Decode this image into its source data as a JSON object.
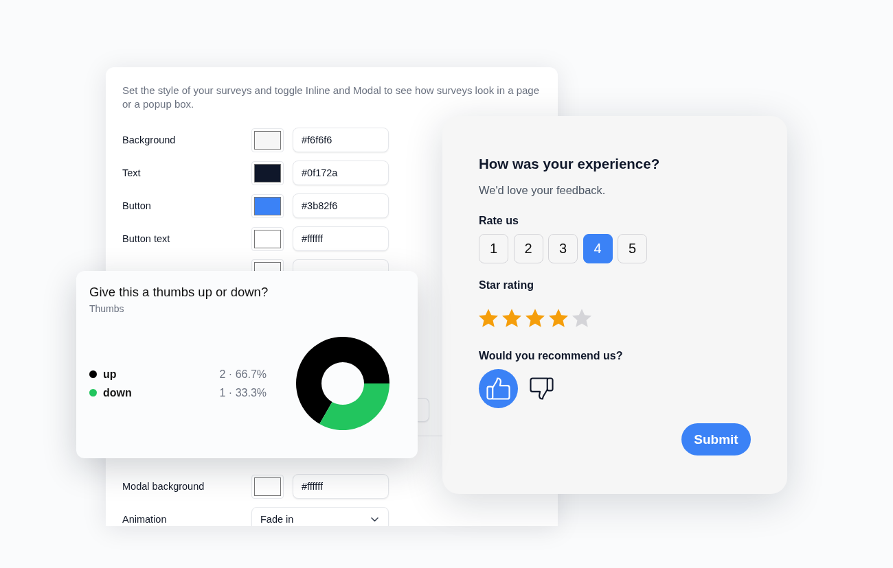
{
  "settings_panel": {
    "description": "Set the style of your surveys and toggle Inline and Modal to see how surveys look in a page or a popup box.",
    "style_rows": [
      {
        "kind": "color",
        "label": "Background",
        "color": "#f6f6f6",
        "value": "#f6f6f6"
      },
      {
        "kind": "color",
        "label": "Text",
        "color": "#0f172a",
        "value": "#0f172a"
      },
      {
        "kind": "color",
        "label": "Button",
        "color": "#3b82f6",
        "value": "#3b82f6"
      },
      {
        "kind": "color",
        "label": "Button text",
        "color": "#ffffff",
        "value": "#ffffff"
      },
      {
        "kind": "partial",
        "color": "#ffffff"
      }
    ],
    "modal_rows": [
      {
        "kind": "color",
        "label": "Modal background",
        "color": "#ffffff",
        "value": "#ffffff"
      },
      {
        "kind": "select",
        "label": "Animation",
        "value": "Fade in"
      }
    ]
  },
  "results_card": {
    "title": "Give this a thumbs up or down?",
    "subtitle": "Thumbs",
    "legend": [
      {
        "reading": "2 · 66.7%",
        "color": "#000000"
      },
      {
        "reading": "1 · 33.3%",
        "color": "#22c55e"
      }
    ],
    "chart_data": {
      "type": "donut",
      "categories": [
        "up",
        "down"
      ],
      "values": [
        66.7,
        33.3
      ]
    }
  },
  "survey_card": {
    "title": "How was your experience?",
    "subtitle": "We'd love your feedback.",
    "rate_label": "Rate us",
    "rate_options": [
      {
        "label": "1",
        "selected": false
      },
      {
        "label": "2",
        "selected": false
      },
      {
        "label": "3",
        "selected": false
      },
      {
        "label": "4",
        "selected": true
      },
      {
        "label": "5",
        "selected": false
      }
    ],
    "star_label": "Star rating",
    "stars": 4,
    "recommend_label": "Would you recommend us?",
    "thumbs": [
      {
        "kind": "up",
        "selected": true
      },
      {
        "kind": "down",
        "selected": false
      }
    ],
    "submit": "Submit"
  }
}
